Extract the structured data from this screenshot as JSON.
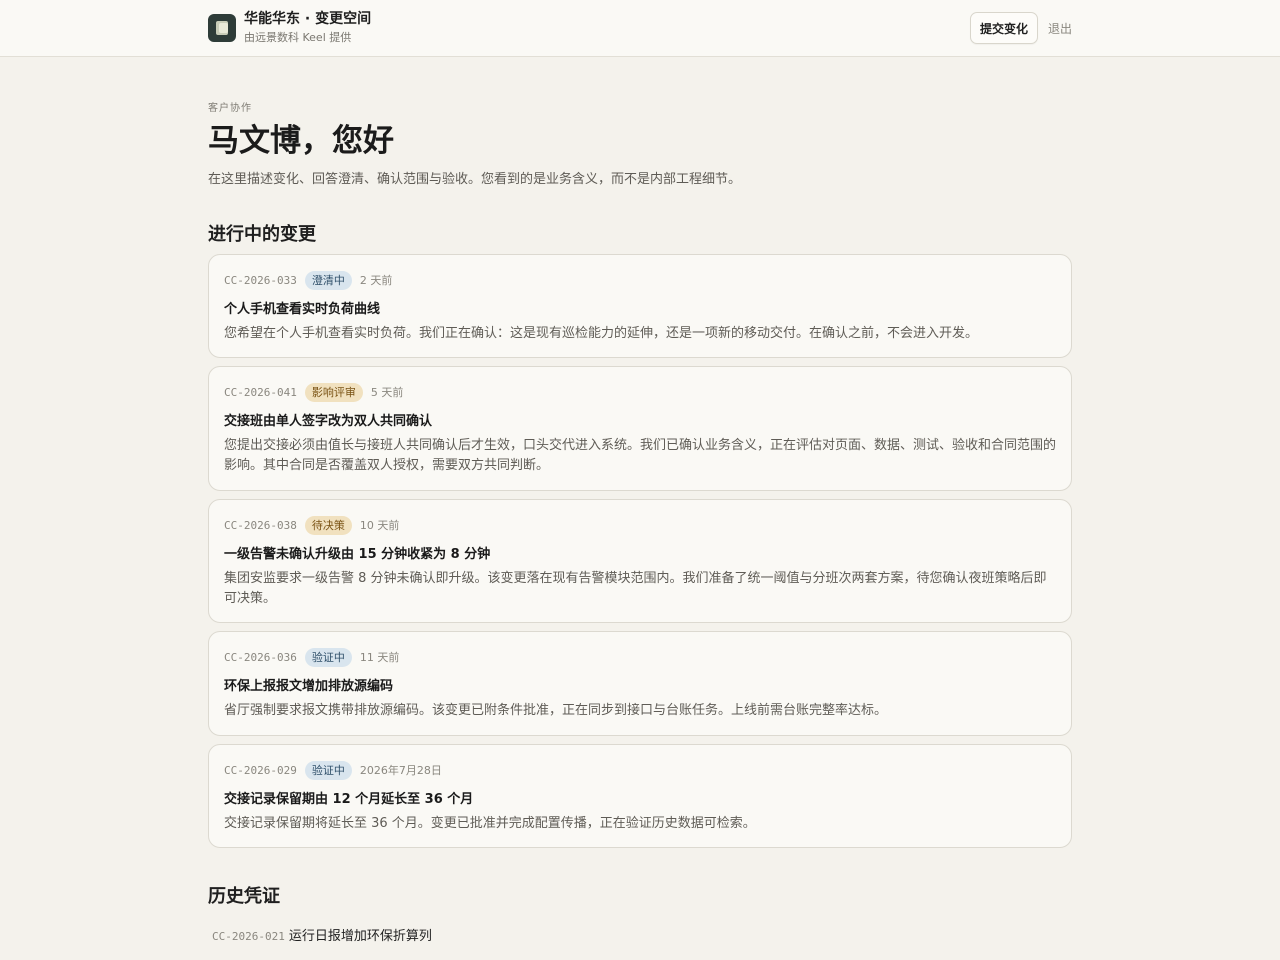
{
  "header": {
    "title": "华能华东 · 变更空间",
    "subtitle": "由远景数科 Keel 提供",
    "logo_icon": "app-logo",
    "submit_label": "提交变化",
    "logout_label": "退出"
  },
  "hero": {
    "eyebrow": "客户协作",
    "greeting": "马文博，您好",
    "intro": "在这里描述变化、回答澄清、确认范围与验收。您看到的是业务含义，而不是内部工程细节。"
  },
  "active": {
    "heading": "进行中的变更",
    "items": [
      {
        "id": "CC-2026-033",
        "status": "澄清中",
        "status_color": "#d9e5ee",
        "time": "2 天前",
        "title": "个人手机查看实时负荷曲线",
        "desc": "您希望在个人手机查看实时负荷。我们正在确认：这是现有巡检能力的延伸，还是一项新的移动交付。在确认之前，不会进入开发。"
      },
      {
        "id": "CC-2026-041",
        "status": "影响评审",
        "status_color": "#f1e1bf",
        "time": "5 天前",
        "title": "交接班由单人签字改为双人共同确认",
        "desc": "您提出交接必须由值长与接班人共同确认后才生效，口头交代进入系统。我们已确认业务含义，正在评估对页面、数据、测试、验收和合同范围的影响。其中合同是否覆盖双人授权，需要双方共同判断。"
      },
      {
        "id": "CC-2026-038",
        "status": "待决策",
        "status_color": "#f1e1bf",
        "time": "10 天前",
        "title": "一级告警未确认升级由 15 分钟收紧为 8 分钟",
        "desc": "集团安监要求一级告警 8 分钟未确认即升级。该变更落在现有告警模块范围内。我们准备了统一阈值与分班次两套方案，待您确认夜班策略后即可决策。"
      },
      {
        "id": "CC-2026-036",
        "status": "验证中",
        "status_color": "#d9e5ee",
        "time": "11 天前",
        "title": "环保上报报文增加排放源编码",
        "desc": "省厅强制要求报文携带排放源编码。该变更已附条件批准，正在同步到接口与台账任务。上线前需台账完整率达标。"
      },
      {
        "id": "CC-2026-029",
        "status": "验证中",
        "status_color": "#d9e5ee",
        "time": "2026年7月28日",
        "title": "交接记录保留期由 12 个月延长至 36 个月",
        "desc": "交接记录保留期将延长至 36 个月。变更已批准并完成配置传播，正在验证历史数据可检索。"
      }
    ]
  },
  "history": {
    "heading": "历史凭证",
    "items": [
      {
        "id": "CC-2026-021",
        "title": "运行日报增加环保折算列"
      }
    ]
  }
}
